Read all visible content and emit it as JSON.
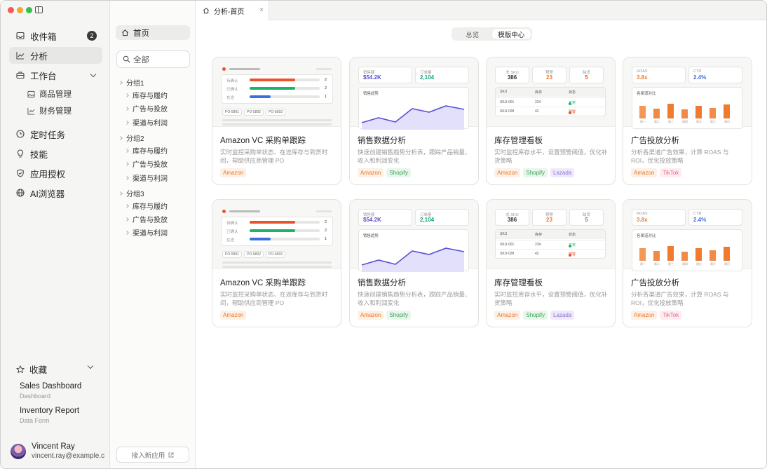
{
  "sidebar": {
    "nav": [
      {
        "label": "收件箱",
        "icon": "inbox-icon",
        "badge": "2"
      },
      {
        "label": "分析",
        "icon": "chart-icon"
      },
      {
        "label": "工作台",
        "icon": "briefcase-icon"
      },
      {
        "label": "定时任务",
        "icon": "clock-icon"
      },
      {
        "label": "技能",
        "icon": "bulb-icon"
      },
      {
        "label": "应用授权",
        "icon": "shield-icon"
      },
      {
        "label": "AI浏览器",
        "icon": "globe-icon"
      }
    ],
    "workbench_sub": [
      {
        "label": "商品管理",
        "icon": "image-icon"
      },
      {
        "label": "财务管理",
        "icon": "chart-icon"
      }
    ],
    "favorites_title": "收藏",
    "favorites": [
      {
        "title": "Sales Dashboard",
        "type": "Dashboard"
      },
      {
        "title": "Inventory Report",
        "type": "Data Form"
      }
    ],
    "user": {
      "name": "Vincent Ray",
      "email": "vincent.ray@example.com"
    }
  },
  "panel": {
    "home": "首页",
    "search_placeholder": "全部",
    "groups": [
      {
        "label": "分组1",
        "items": [
          "库存与履约",
          "广告与投放",
          "渠道与利润"
        ]
      },
      {
        "label": "分组2",
        "items": [
          "库存与履约",
          "广告与投放",
          "渠道与利润"
        ]
      },
      {
        "label": "分组3",
        "items": [
          "库存与履约",
          "广告与投放",
          "渠道与利润"
        ]
      }
    ],
    "connect": "接入新应用"
  },
  "tab": {
    "label": "分析-首页",
    "close": "×"
  },
  "segment": {
    "overview": "总览",
    "templates": "模版中心"
  },
  "colors": {
    "orange": "#f07a2e",
    "green": "#1fb36a",
    "blue": "#3b6fe0",
    "purple": "#5b4fd6",
    "red": "#e8552a",
    "teal": "#13a178"
  },
  "cards": [
    {
      "title": "Amazon VC 采购单跟踪",
      "desc": "实时监控采购单状态、在途库存与到货时间，帮助供应商管理 PO",
      "tags": [
        "Amazon"
      ],
      "thumb": {
        "rows": [
          {
            "label": "待确认",
            "value": "2",
            "fill": 0.65
          },
          {
            "label": "已确认",
            "value": "2",
            "fill": 0.65
          },
          {
            "label": "在途",
            "value": "1",
            "fill": 0.3
          }
        ],
        "chips": [
          "PO-5891",
          "PO-5892",
          "PO-5893"
        ]
      }
    },
    {
      "title": "销售数据分析",
      "desc": "快速创建销售趋势分析表，跟踪产品销量、收入和利润变化",
      "tags": [
        "Amazon",
        "Shopify"
      ],
      "thumb": {
        "kpi1_label": "销售额",
        "kpi1_value": "$54.2K",
        "kpi2_label": "订单量",
        "kpi2_value": "2,104",
        "chart_label": "销售趋势"
      }
    },
    {
      "title": "库存管理看板",
      "desc": "实时监控库存水平，设置预警阈值，优化补货策略",
      "tags": [
        "Amazon",
        "Shopify",
        "Lazada"
      ],
      "thumb": {
        "kpis": [
          {
            "label": "总 SKU",
            "value": "386"
          },
          {
            "label": "预警",
            "value": "23"
          },
          {
            "label": "缺货",
            "value": "5"
          }
        ],
        "headers": [
          "SKU",
          "库存",
          "状态"
        ],
        "rows": [
          {
            "sku": "SKU-001",
            "qty": "234",
            "status": "正常"
          },
          {
            "sku": "SKU-028",
            "qty": "42",
            "status": "预警"
          }
        ]
      }
    },
    {
      "title": "广告投放分析",
      "desc": "分析各渠道广告效果，计算 ROAS 与 ROI，优化投放策略",
      "tags": [
        "Amazon",
        "TikTok"
      ],
      "thumb": {
        "kpi1_label": "ROAS",
        "kpi1_value": "3.8x",
        "kpi2_label": "CTR",
        "kpi2_value": "2.4%",
        "chart_label": "各渠道对比",
        "days": [
          "周一",
          "周二",
          "周三",
          "周四",
          "周五",
          "周六",
          "周日"
        ],
        "heights": [
          0.55,
          0.45,
          0.65,
          0.4,
          0.55,
          0.48,
          0.62
        ]
      }
    }
  ]
}
